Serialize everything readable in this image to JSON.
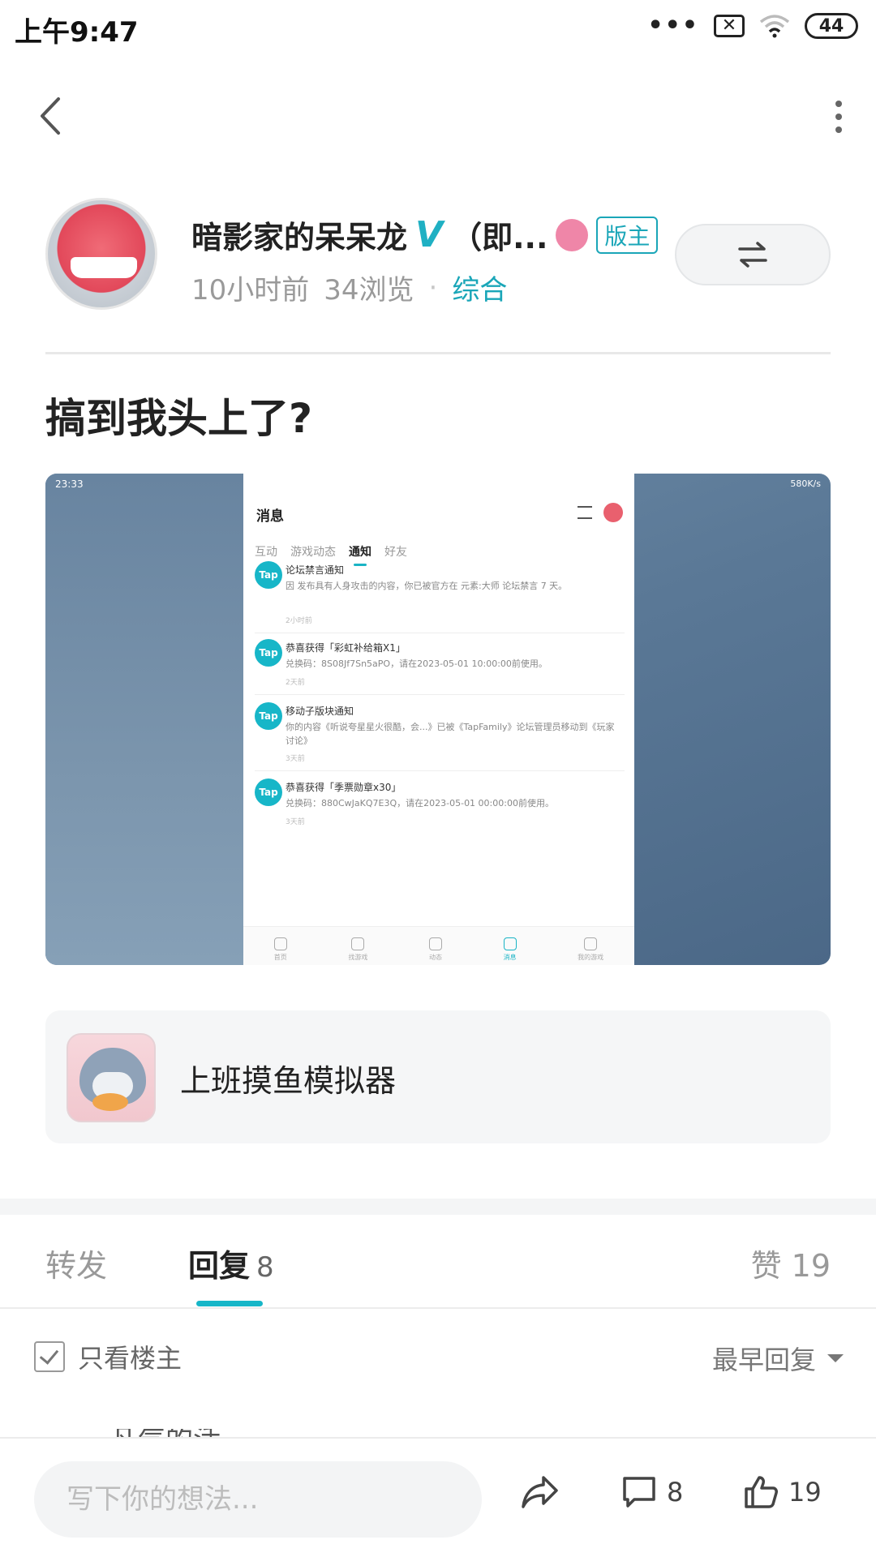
{
  "status_bar": {
    "time": "上午9:47",
    "dots": "•••",
    "sim_icon": "✕",
    "battery": "44"
  },
  "nav": {
    "back_icon": "chevron-left",
    "more_icon": "vertical-dots"
  },
  "author": {
    "name": "暗影家的呆呆龙",
    "verified": "V",
    "name_suffix": "（即...",
    "moderator_badge": "版主",
    "time_ago": "10小时前",
    "views": "34浏览",
    "separator": "·",
    "category": "综合"
  },
  "post": {
    "title": "搞到我头上了?",
    "screenshot": {
      "time": "23:33",
      "net_speed": "580K/s",
      "header": "消息",
      "tabs": [
        "互动",
        "游戏动态",
        "通知",
        "好友"
      ],
      "active_tab": "通知",
      "notifications": [
        {
          "icon": "Tap",
          "title": "论坛禁言通知",
          "body": "因 发布具有人身攻击的内容，你已被官方在 元素:大师 论坛禁言 7 天。",
          "time": "2小时前"
        },
        {
          "icon": "Tap",
          "title": "恭喜获得「彩虹补给箱X1」",
          "body": "兑换码：8S08Jf7Sn5aPO，请在2023-05-01 10:00:00前使用。",
          "time": "2天前"
        },
        {
          "icon": "Tap",
          "title": "移动子版块通知",
          "body": "你的内容《听说夸星星火很酷，会...》已被《TapFamily》论坛管理员移动到《玩家讨论》",
          "time": "3天前"
        },
        {
          "icon": "Tap",
          "title": "恭喜获得「季票勋章x30」",
          "body": "兑换码：880CwJaKQ7E3Q，请在2023-05-01 00:00:00前使用。",
          "time": "3天前"
        }
      ],
      "bottom_nav": [
        "首页",
        "找游戏",
        "动态",
        "消息",
        "我的游戏"
      ],
      "bottom_active": "消息"
    }
  },
  "game": {
    "name": "上班摸鱼模拟器"
  },
  "tabs": {
    "share": "转发",
    "reply": "回复",
    "reply_count": "8",
    "like": "赞 19"
  },
  "filter": {
    "only_op": "只看楼主",
    "sort": "最早回复"
  },
  "peek_text": "凡气的活",
  "bottom": {
    "placeholder": "写下你的想法...",
    "comment_count": "8",
    "like_count": "19"
  },
  "colors": {
    "accent": "#17b6c8",
    "text": "#222222",
    "muted": "#999999"
  }
}
